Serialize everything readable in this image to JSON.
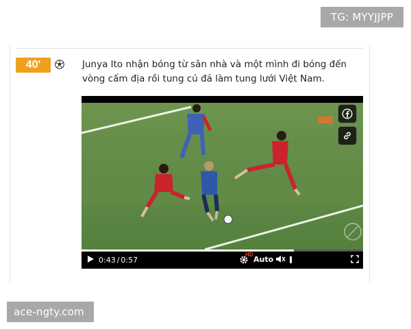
{
  "watermarks": {
    "top_right": "TG: MYYJJPP",
    "bottom_left": "ace-ngty.com"
  },
  "event": {
    "minute": "40'",
    "icon": "soccer-ball-icon",
    "text": "Junya Ito nhận bóng từ sân nhà và một mình đi bóng đến vòng cấm địa rồi tung cú đá làm tung lưới Việt Nam."
  },
  "video": {
    "current_time": "0:43",
    "duration": "0:57",
    "progress": 0.754,
    "quality_badge": "HD",
    "quality_label": "Auto",
    "overlay_buttons": [
      "facebook-icon",
      "link-icon"
    ],
    "controls_icons": [
      "play-icon",
      "settings-icon",
      "volume-icon",
      "fullscreen-icon"
    ]
  },
  "colors": {
    "minute_badge": "#f0a01e",
    "pitch": "#5f8a45",
    "watermark_bg": "#a8a8a8"
  }
}
